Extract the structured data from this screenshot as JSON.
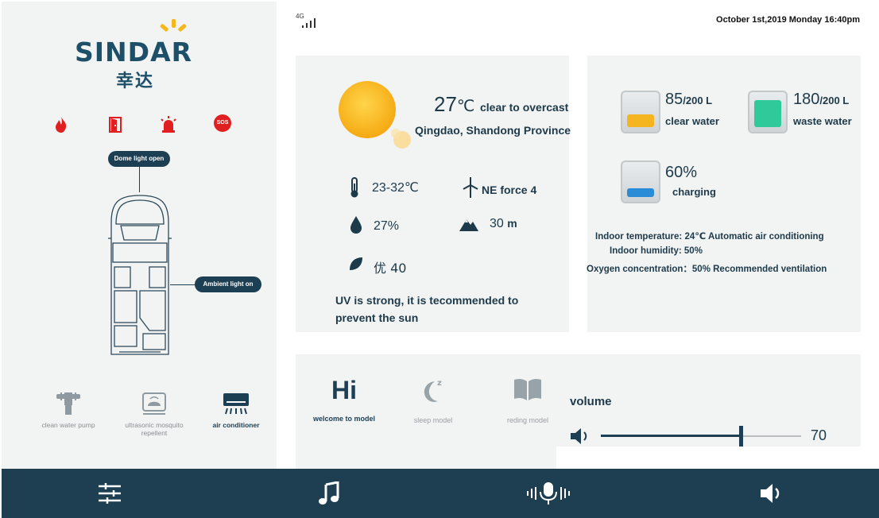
{
  "brand": {
    "name_left": "SIND",
    "name_a": "A",
    "name_right": "R",
    "chinese": "幸达"
  },
  "status": {
    "network": "4G",
    "datetime": "October 1st,2019 Monday 16:40pm"
  },
  "alerts": [
    {
      "icon": "fire-icon"
    },
    {
      "icon": "door-icon"
    },
    {
      "icon": "alarm-icon"
    },
    {
      "icon": "sos-icon",
      "label": "SOS"
    }
  ],
  "vehicle": {
    "dome_light": "Dome light open",
    "ambient_light": "Ambient light on"
  },
  "devices": [
    {
      "icon": "water-pump-icon",
      "label": "clean water pump",
      "active": false
    },
    {
      "icon": "ultrasonic-icon",
      "label": "ultrasonic mosquito repellent",
      "active": false
    },
    {
      "icon": "air-conditioner-icon",
      "label": "air conditioner",
      "active": true
    }
  ],
  "weather": {
    "temp_value": "27",
    "temp_unit": "℃",
    "condition": "clear to overcast",
    "location": "Qingdao, Shandong Province",
    "range": "23-32℃",
    "wind": "NE force 4",
    "humidity": "27%",
    "altitude_value": "30",
    "altitude_unit": "m",
    "air_quality_cn": "优",
    "air_quality_value": "40",
    "advice_line1": "UV is strong, it is tecommended to",
    "advice_line2": "prevent the sun"
  },
  "environment": {
    "clear_water": {
      "value": "85",
      "capacity": "/200 L",
      "label": "clear water",
      "level": 0.425
    },
    "waste_water": {
      "value": "180",
      "capacity": "/200 L",
      "label": "waste water",
      "level": 0.9
    },
    "battery": {
      "value": "60%",
      "label": "charging",
      "level": 0.6
    },
    "indoor_temp": "Indoor temperature: 24℃  Automatic air conditioning",
    "indoor_humidity": "Indoor humidity:  50%",
    "oxygen": "Oxygen concentration：50%  Recommended ventilation"
  },
  "modes": [
    {
      "icon": "hi-icon",
      "glyph": "Hi",
      "label": "welcome to model",
      "active": true
    },
    {
      "icon": "moon-icon",
      "label": "sleep model",
      "active": false
    },
    {
      "icon": "book-icon",
      "label": "reding model",
      "active": false
    }
  ],
  "volume": {
    "label": "volume",
    "value": "70",
    "level": 0.7
  },
  "nav": [
    {
      "icon": "settings-sliders-icon"
    },
    {
      "icon": "music-note-icon"
    },
    {
      "icon": "microphone-icon"
    },
    {
      "icon": "speaker-icon"
    }
  ],
  "colors": {
    "primary": "#1e3e51",
    "panel": "#f2f3f3",
    "alert": "#e02020",
    "sun": "#f7bf1f",
    "clear_water": "#f5b520",
    "waste_water": "#30c99a",
    "battery": "#2a8bd6"
  }
}
